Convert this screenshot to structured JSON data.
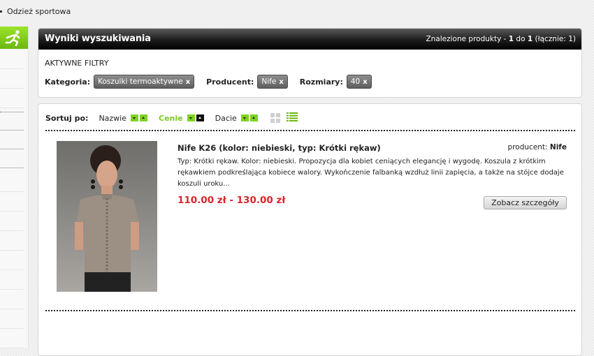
{
  "breadcrumb": {
    "label": "Odzież sportowa"
  },
  "results": {
    "title": "Wyniki wyszukiwania",
    "count_prefix": "Znalezione produkty - ",
    "from": "1",
    "to_word": " do ",
    "to": "1",
    "total_text": " (łącznie: 1)"
  },
  "filters": {
    "heading": "AKTYWNE FILTRY",
    "items": [
      {
        "label": "Kategoria:",
        "value": "Koszulki termoaktywne"
      },
      {
        "label": "Producent:",
        "value": "Nife"
      },
      {
        "label": "Rozmiary:",
        "value": "40"
      }
    ],
    "remove_glyph": "x"
  },
  "sort": {
    "label": "Sortuj po:",
    "options": [
      "Nazwie",
      "Cenie",
      "Dacie"
    ],
    "active": "Cenie",
    "active_direction": "asc"
  },
  "product": {
    "title": "Nife K26 (kolor: niebieski, typ: Krótki rękaw)",
    "producer_label": "producent:",
    "producer_name": "Nife",
    "description": "Typ: Krótki rękaw. Kolor: niebieski. Propozycja dla kobiet ceniących elegancję i wygodę. Koszula z krótkim rękawkiem podkreślająca kobiece walory. Wykończenie falbanką wzdłuż linii zapięcia, a także na stójce dodaje koszuli uroku...",
    "price": "110.00 zł - 130.00 zł",
    "details_button": "Zobacz szczegóły"
  },
  "colors": {
    "accent": "#7ed321",
    "price": "#d9262c",
    "header": "#1c1c1c"
  },
  "icons": {
    "sport": "runner-icon",
    "grid_view": "grid-view-icon",
    "list_view": "list-view-icon"
  }
}
